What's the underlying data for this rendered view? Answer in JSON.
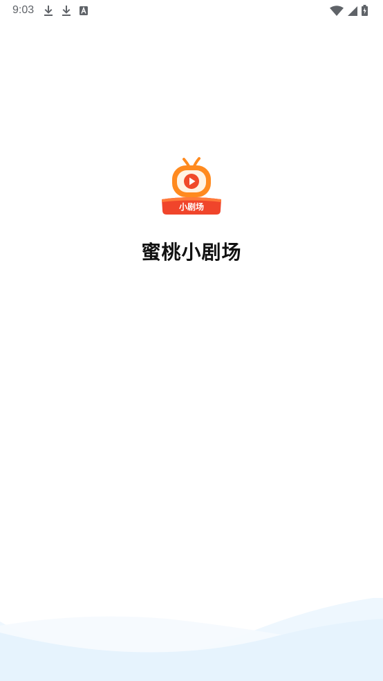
{
  "status_bar": {
    "time": "9:03",
    "left_icons": [
      "download-icon",
      "download-icon",
      "keyboard-a-icon"
    ],
    "right_icons": [
      "wifi-icon",
      "cellular-signal-icon",
      "battery-icon"
    ]
  },
  "splash": {
    "logo_text": "小剧场",
    "app_name": "蜜桃小剧场",
    "colors": {
      "tv_orange": "#FF8A1F",
      "play_red": "#F04A2A",
      "banner_red": "#F0452B",
      "wave_blue": "#E6F3FD"
    }
  }
}
